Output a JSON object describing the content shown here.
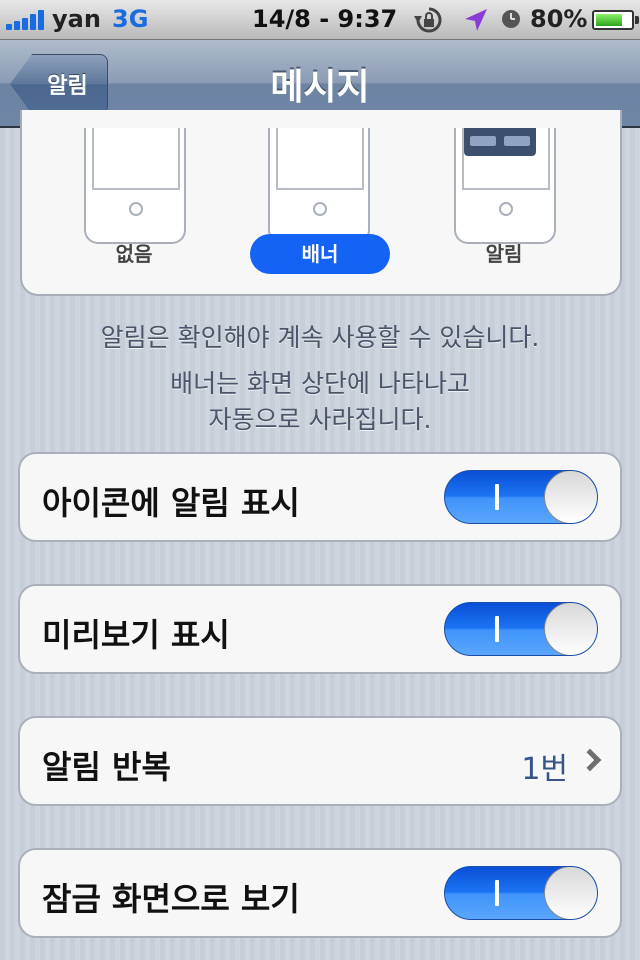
{
  "status_bar": {
    "carrier": "yan",
    "network": "3G",
    "time": "14/8 - 9:37",
    "battery_percent": "80%",
    "battery_level": 0.8,
    "icons": [
      "signal-bars-icon",
      "rotation-lock-icon",
      "location-arrow-icon",
      "alarm-clock-icon",
      "battery-icon"
    ]
  },
  "nav": {
    "back_label": "알림",
    "title": "메시지"
  },
  "alert_styles": {
    "options": [
      {
        "label": "없음",
        "selected": false
      },
      {
        "label": "배너",
        "selected": true
      },
      {
        "label": "알림",
        "selected": false
      }
    ]
  },
  "description": {
    "line1": "알림은 확인해야 계속 사용할 수 있습니다.",
    "line2": "배너는 화면 상단에 나타나고",
    "line3": "자동으로 사라집니다."
  },
  "settings": {
    "badge": {
      "label": "아이콘에 알림 표시",
      "on": true
    },
    "preview": {
      "label": "미리보기 표시",
      "on": true
    },
    "repeat": {
      "label": "알림 반복",
      "value": "1번"
    },
    "lock_screen": {
      "label": "잠금 화면으로 보기",
      "on": true
    }
  },
  "colors": {
    "toggle_on": "#1b74f3",
    "selected_style": "#1463f5",
    "nav_bar": "#6e85a4",
    "detail_text": "#385487"
  }
}
